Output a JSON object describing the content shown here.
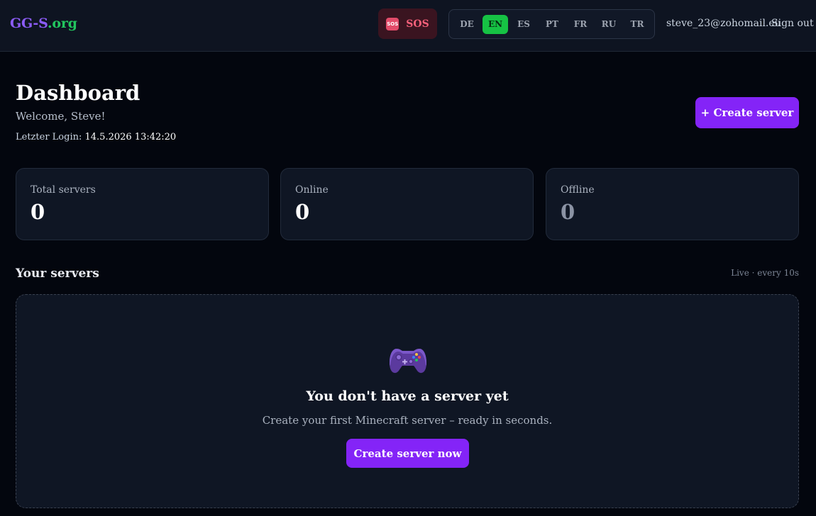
{
  "header": {
    "logo_part1": "GG-S",
    "logo_part2": ".org",
    "sos_icon_text": "SOS",
    "sos_label": "SOS",
    "languages": [
      "DE",
      "EN",
      "ES",
      "PT",
      "FR",
      "RU",
      "TR"
    ],
    "active_language": "EN",
    "user_email": "steve_23@zohomail.eu",
    "sign_out_label": "Sign out"
  },
  "page": {
    "title": "Dashboard",
    "welcome": "Welcome, Steve!",
    "last_login_label": "Letzter Login:",
    "last_login_value": "14.5.2026 13:42:20",
    "create_button": "+ Create server"
  },
  "stats": [
    {
      "label": "Total servers",
      "value": "0"
    },
    {
      "label": "Online",
      "value": "0"
    },
    {
      "label": "Offline",
      "value": "0"
    }
  ],
  "servers": {
    "section_title": "Your servers",
    "live_label": "Live · every 10s",
    "empty_icon": "gamepad-icon",
    "empty_title": "You don't have a server yet",
    "empty_description": "Create your first Minecraft server – ready in seconds.",
    "empty_button": "Create server now"
  },
  "colors": {
    "accent": "#8424f7",
    "brand_purple": "#8b5cf6",
    "brand_green": "#22c55e",
    "active_lang": "#16c244",
    "sos": "#f4607a"
  }
}
